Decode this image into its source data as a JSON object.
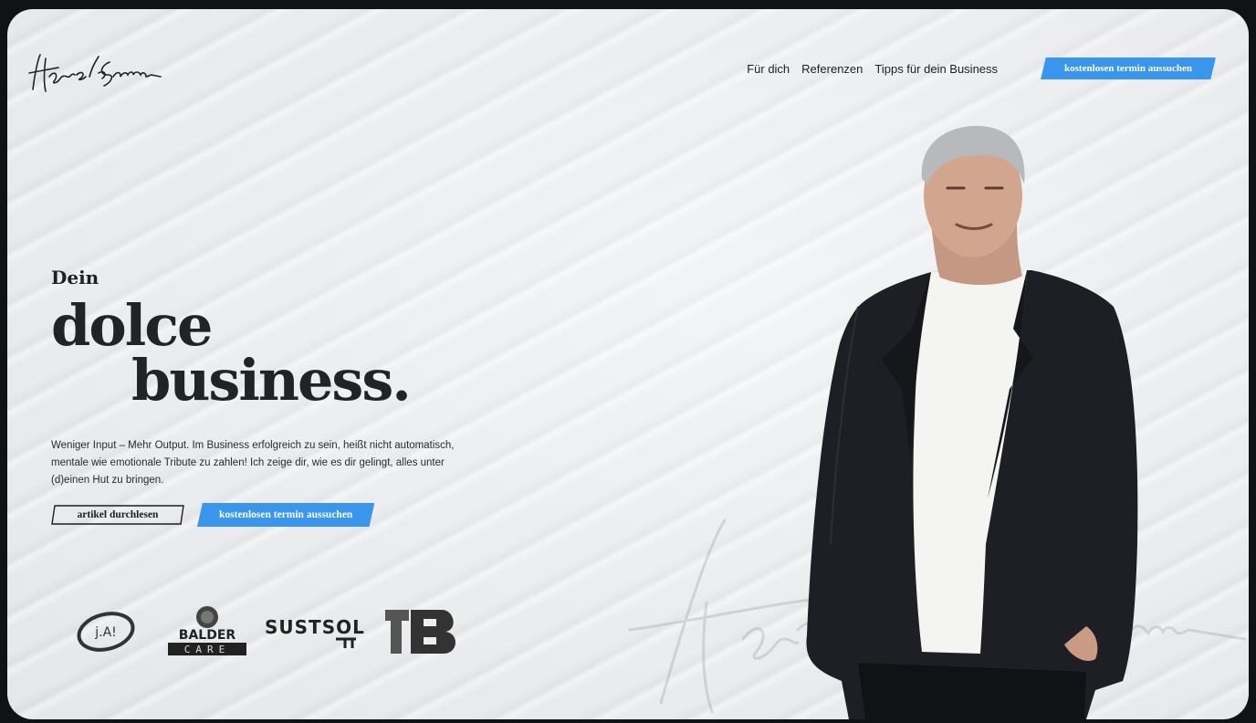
{
  "brand": {
    "signature": "Harald Schemmer"
  },
  "nav": {
    "links": [
      "Für dich",
      "Referenzen",
      "Tipps für dein Business"
    ],
    "cta": "kostenlosen termin aussuchen"
  },
  "hero": {
    "kicker": "Dein",
    "headline_line1": "dolce",
    "headline_line2": "business.",
    "intro": "Weniger Input – Mehr Output. Im Business erfolgreich zu sein, heißt nicht automatisch, mentale wie emotionale Tribute zu zahlen! Ich zeige dir, wie es dir gelingt, alles unter (d)einen Hut zu bringen.",
    "secondary_button": "artikel durchlesen",
    "primary_button": "kostenlosen termin aussuchen"
  },
  "clients": {
    "ja": "j.A!",
    "balder_top": "BALDER",
    "balder_bottom": "CARE",
    "sustsol": "SUSTSOL"
  },
  "colors": {
    "accent": "#3996ec",
    "text": "#1f2022",
    "background": "#eceef1"
  }
}
